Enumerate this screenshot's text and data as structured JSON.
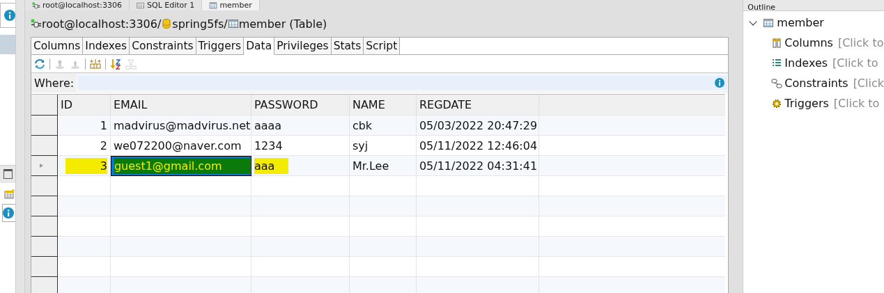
{
  "editor_tabs": [
    {
      "label": "root@localhost:3306",
      "kind": "connection",
      "selected": false
    },
    {
      "label": "SQL Editor 1",
      "kind": "sql",
      "selected": false
    },
    {
      "label": "member",
      "kind": "table",
      "selected": true
    }
  ],
  "breadcrumb": [
    {
      "label": "root@localhost:3306/",
      "kind": "connection"
    },
    {
      "label": "spring5fs/",
      "kind": "database"
    },
    {
      "label": "member (Table)",
      "kind": "table"
    }
  ],
  "tabs": [
    {
      "label": "Columns",
      "selected": false
    },
    {
      "label": "Indexes",
      "selected": false
    },
    {
      "label": "Constraints",
      "selected": false
    },
    {
      "label": "Triggers",
      "selected": false
    },
    {
      "label": "Data",
      "selected": true
    },
    {
      "label": "Privileges",
      "selected": false
    },
    {
      "label": "Stats",
      "selected": false
    },
    {
      "label": "Script",
      "selected": false
    }
  ],
  "toolbar": [
    {
      "kind": "refresh",
      "disabled": false
    },
    {
      "kind": "sep"
    },
    {
      "kind": "import",
      "disabled": true
    },
    {
      "kind": "export",
      "disabled": true
    },
    {
      "kind": "sep"
    },
    {
      "kind": "fit",
      "disabled": false
    },
    {
      "kind": "sep"
    },
    {
      "kind": "sort",
      "disabled": false
    },
    {
      "kind": "filter",
      "disabled": true
    }
  ],
  "where": {
    "label": "Where:"
  },
  "table": {
    "columns": [
      "ID",
      "EMAIL",
      "PASSWORD",
      "NAME",
      "REGDATE"
    ],
    "rows": [
      {
        "selected": false,
        "cells": [
          {
            "text": "1",
            "highlighted": false,
            "focused": false
          },
          {
            "text": "madvirus@madvirus.net",
            "highlighted": false,
            "focused": false
          },
          {
            "text": "aaaa",
            "highlighted": false,
            "focused": false
          },
          {
            "text": "cbk",
            "highlighted": false,
            "focused": false
          },
          {
            "text": "05/03/2022 20:47:29",
            "highlighted": false,
            "focused": false
          }
        ]
      },
      {
        "selected": false,
        "cells": [
          {
            "text": "2",
            "highlighted": false,
            "focused": false
          },
          {
            "text": "we072200@naver.com",
            "highlighted": false,
            "focused": false
          },
          {
            "text": "1234",
            "highlighted": false,
            "focused": false
          },
          {
            "text": "syj",
            "highlighted": false,
            "focused": false
          },
          {
            "text": "05/11/2022 12:46:04",
            "highlighted": false,
            "focused": false
          }
        ]
      },
      {
        "selected": true,
        "cells": [
          {
            "text": "3",
            "highlighted": true,
            "focused": false
          },
          {
            "text": "guest1@gmail.com",
            "highlighted": true,
            "focused": true
          },
          {
            "text": "aaa",
            "highlighted": true,
            "focused": false
          },
          {
            "text": "Mr.Lee",
            "highlighted": false,
            "focused": false
          },
          {
            "text": "05/11/2022 04:31:41",
            "highlighted": false,
            "focused": false
          }
        ]
      }
    ]
  },
  "outline": {
    "title": "Outline",
    "root": {
      "label": "member",
      "expanded": true,
      "children": [
        {
          "label": "Columns",
          "hint": "[Click to",
          "kind": "columns"
        },
        {
          "label": "Indexes",
          "hint": "[Click to",
          "kind": "indexes"
        },
        {
          "label": "Constraints",
          "hint": "[Click",
          "kind": "constraints"
        },
        {
          "label": "Triggers",
          "hint": "[Click to",
          "kind": "triggers"
        }
      ]
    }
  }
}
